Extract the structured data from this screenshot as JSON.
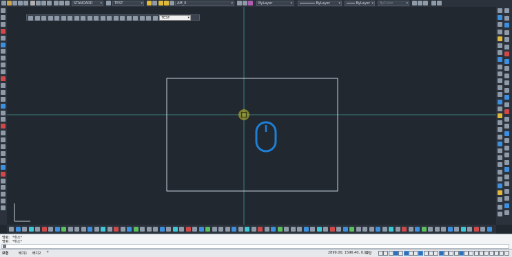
{
  "top_toolbar": {
    "text_style": "STANDARD",
    "dim_style": "TEST",
    "layer": "AM_0",
    "color": "ByLayer",
    "linetype": "ByLayer",
    "lineweight": "ByLayer",
    "plot_style": "ByColor"
  },
  "dim_toolbar": {
    "dim_style": "TEST"
  },
  "command_history": [
    {
      "prefix": "명령:",
      "text": "*취소*"
    },
    {
      "prefix": "명령:",
      "text": "*취소*"
    }
  ],
  "command_input": {
    "placeholder": ""
  },
  "layout_tabs": [
    {
      "label": "모형",
      "active": true
    },
    {
      "label": "배치1",
      "active": false
    },
    {
      "label": "배치2",
      "active": false
    },
    {
      "label": "+",
      "active": false
    }
  ],
  "status_bar": {
    "coordinates": "2899.00, 1596.40, 0.00",
    "model_label": "모형"
  },
  "colors": {
    "canvas": "#212830",
    "crosshair": "#4fc6b8",
    "rectangle": "#c9d4de",
    "mouse_icon": "#1f7fd6",
    "snap_marker": "#c8c22a"
  }
}
